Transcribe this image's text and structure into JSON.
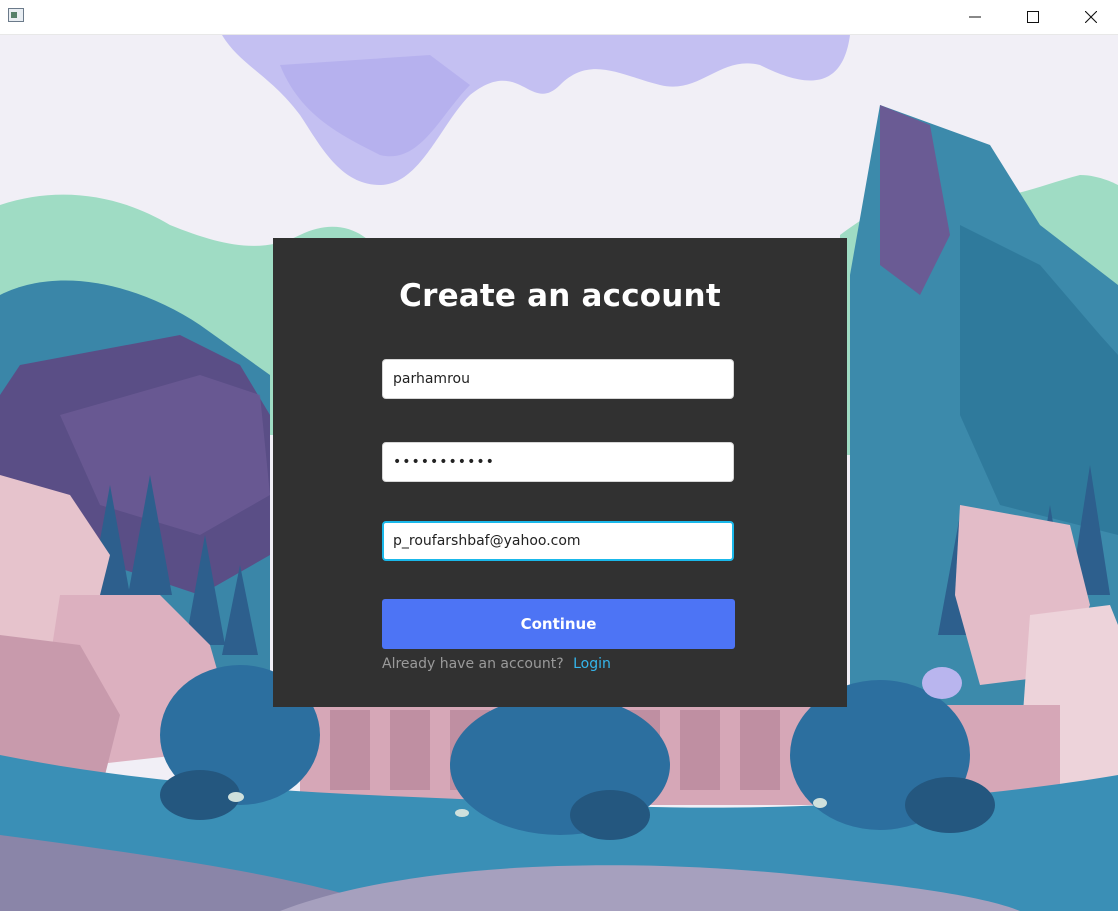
{
  "window": {
    "icon": "app-window-icon",
    "controls": {
      "minimize_icon": "minimize-icon",
      "maximize_icon": "maximize-icon",
      "close_icon": "close-icon"
    }
  },
  "form": {
    "title": "Create an account",
    "username_value": "parhamrou",
    "password_value": "parhamrou12",
    "email_value": "p_roufarshbaf@yahoo.com",
    "continue_label": "Continue",
    "login_prompt": "Already have an account?",
    "login_link": "Login"
  },
  "colors": {
    "panel": "#313131",
    "button": "#4d74f5",
    "link": "#35b6ec",
    "focus_border": "#1ab8ea"
  }
}
